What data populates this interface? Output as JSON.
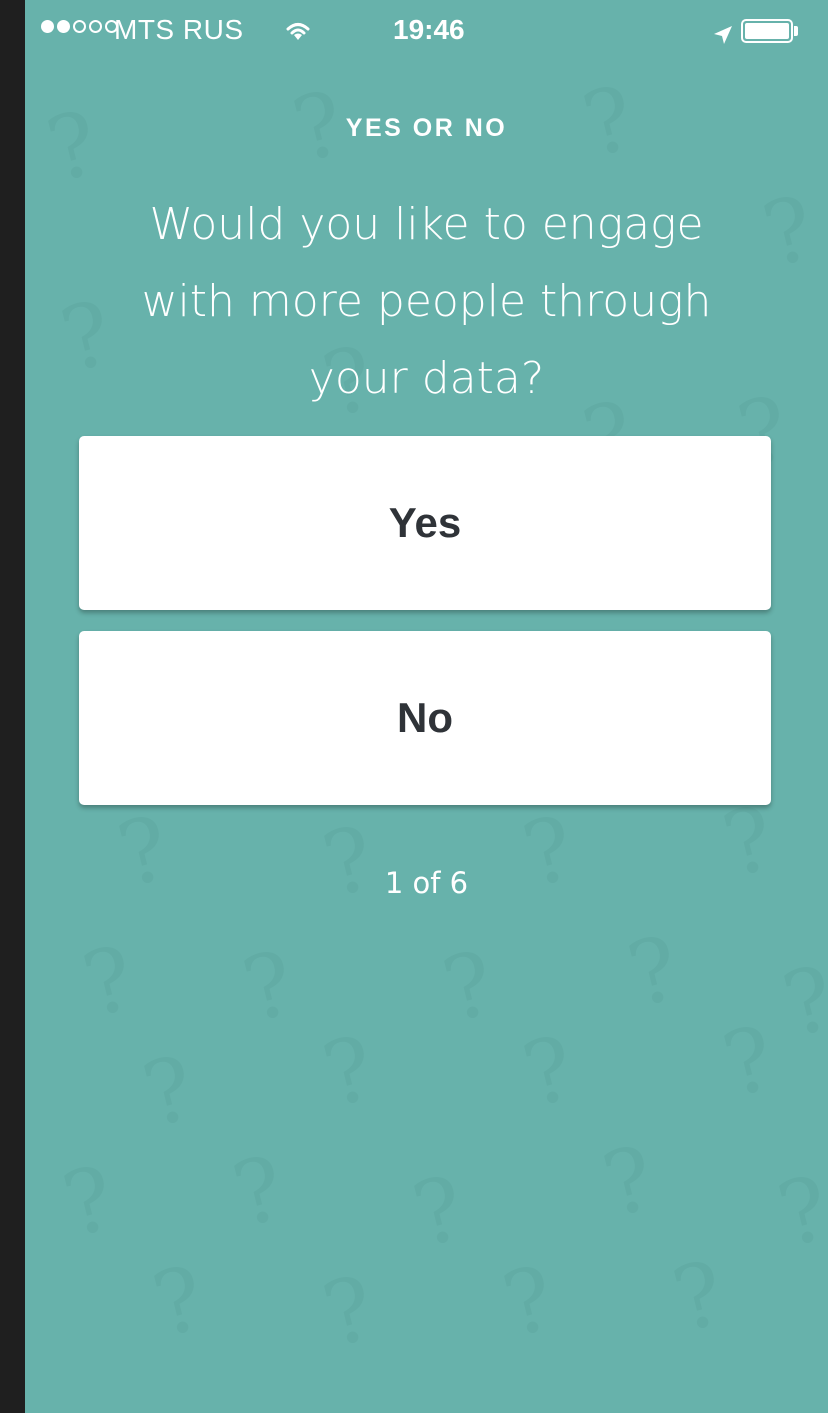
{
  "status_bar": {
    "carrier": "MTS RUS",
    "time": "19:46",
    "signal_bars_filled": 2,
    "signal_bars_total": 5,
    "icons": [
      "signal-dots-icon",
      "wifi-icon",
      "location-arrow-icon",
      "battery-icon"
    ]
  },
  "quiz": {
    "section_label": "YES OR NO",
    "question_lines": [
      "Would you like to engage",
      "with more people through",
      "your data?"
    ],
    "options": [
      "Yes",
      "No"
    ],
    "progress": "1 of 6"
  },
  "colors": {
    "background": "#67b2ab",
    "button_background": "#ffffff",
    "button_text": "#2f3338",
    "text": "#ffffff"
  }
}
